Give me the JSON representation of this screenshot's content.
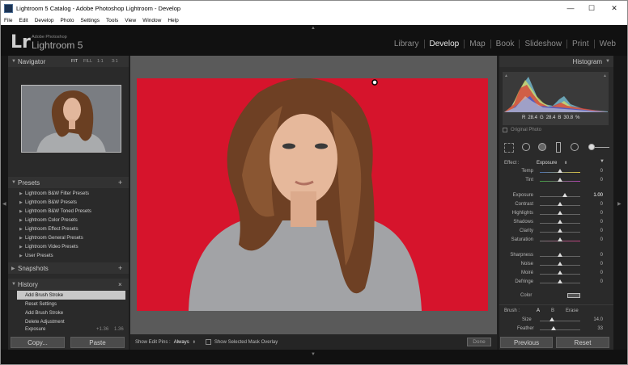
{
  "window": {
    "title": "Lightroom 5 Catalog - Adobe Photoshop Lightroom - Develop",
    "minimize": "—",
    "maximize": "☐",
    "close": "✕"
  },
  "menu": [
    "File",
    "Edit",
    "Develop",
    "Photo",
    "Settings",
    "Tools",
    "View",
    "Window",
    "Help"
  ],
  "brand": {
    "logo": "Lr",
    "line1": "Adobe Photoshop",
    "line2": "Lightroom 5"
  },
  "modules": [
    "Library",
    "Develop",
    "Map",
    "Book",
    "Slideshow",
    "Print",
    "Web"
  ],
  "navigator": {
    "title": "Navigator",
    "fit": "FIT",
    "fill": "FILL",
    "one": "1:1",
    "three": "3:1"
  },
  "presets": {
    "title": "Presets",
    "add": "+",
    "items": [
      "Lightroom B&W Filter Presets",
      "Lightroom B&W Presets",
      "Lightroom B&W Toned Presets",
      "Lightroom Color Presets",
      "Lightroom Effect Presets",
      "Lightroom General Presets",
      "Lightroom Video Presets",
      "User Presets"
    ]
  },
  "snapshots": {
    "title": "Snapshots",
    "add": "+"
  },
  "history": {
    "title": "History",
    "close": "×",
    "items": [
      {
        "label": "Add Brush Stroke",
        "a": "",
        "b": ""
      },
      {
        "label": "Reset Settings",
        "a": "",
        "b": ""
      },
      {
        "label": "Add Brush Stroke",
        "a": "",
        "b": ""
      },
      {
        "label": "Delete Adjustment",
        "a": "",
        "b": ""
      },
      {
        "label": "Exposure",
        "a": "+1.36",
        "b": "1.36"
      }
    ]
  },
  "left_buttons": {
    "copy": "Copy...",
    "paste": "Paste"
  },
  "toolbar": {
    "pins_label": "Show Edit Pins :",
    "pins_value": "Always",
    "overlay": "Show Selected Mask Overlay",
    "done": "Done"
  },
  "histogram": {
    "title": "Histogram",
    "r_label": "R",
    "r": "28.4",
    "g_label": "G",
    "g": "28.4",
    "b_label": "B",
    "b": "30.8",
    "pct": "%",
    "original": "Original Photo"
  },
  "mask": {
    "effect_label": "Effect :",
    "effect_value": "Exposure"
  },
  "sliders": [
    {
      "label": "Temp",
      "value": "0",
      "pos": 0.5
    },
    {
      "label": "Tint",
      "value": "0",
      "pos": 0.5
    },
    {
      "label": "Exposure",
      "value": "1.00",
      "pos": 0.62
    },
    {
      "label": "Contrast",
      "value": "0",
      "pos": 0.5
    },
    {
      "label": "Highlights",
      "value": "0",
      "pos": 0.5
    },
    {
      "label": "Shadows",
      "value": "0",
      "pos": 0.5
    },
    {
      "label": "Clarity",
      "value": "0",
      "pos": 0.5
    },
    {
      "label": "Saturation",
      "value": "0",
      "pos": 0.5
    },
    {
      "label": "Sharpness",
      "value": "0",
      "pos": 0.5
    },
    {
      "label": "Noise",
      "value": "0",
      "pos": 0.5
    },
    {
      "label": "Moiré",
      "value": "0",
      "pos": 0.5
    },
    {
      "label": "Defringe",
      "value": "0",
      "pos": 0.5
    }
  ],
  "color_label": "Color",
  "brush": {
    "label": "Brush :",
    "a": "A",
    "b": "B",
    "erase": "Erase",
    "size_label": "Size",
    "size": "14.0",
    "size_pos": 0.3,
    "feather_label": "Feather",
    "feather": "33",
    "feather_pos": 0.33
  },
  "right_buttons": {
    "previous": "Previous",
    "reset": "Reset"
  },
  "colors": {
    "accent": "#d4122a",
    "panel": "#2a2a2a",
    "background": "#1e1e1e"
  }
}
